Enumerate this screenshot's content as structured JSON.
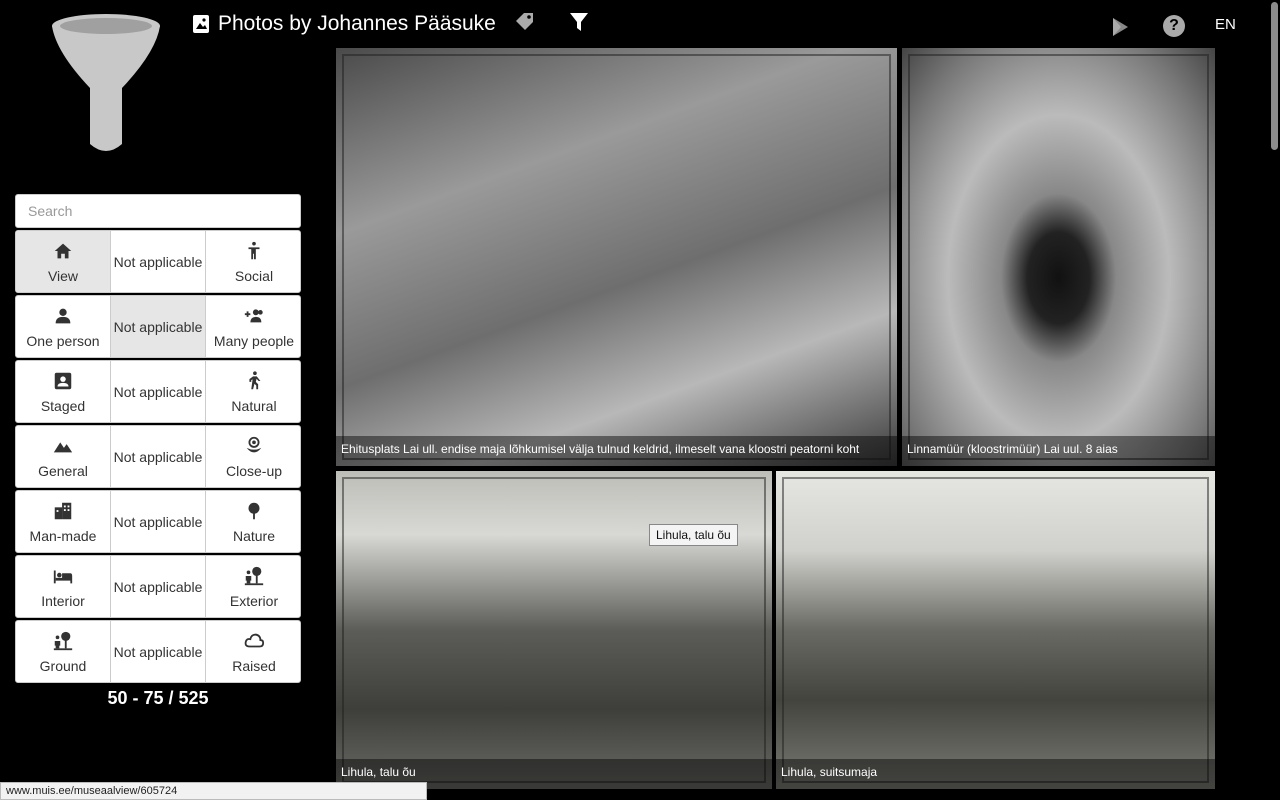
{
  "header": {
    "title": "Photos by Johannes Pääsuke",
    "language": "EN"
  },
  "icons": {
    "logo": "funnel-icon",
    "album": "image-icon",
    "tag": "tag-icon",
    "filter": "filter-icon",
    "play": "play-icon",
    "help": "help-icon"
  },
  "help_glyph": "?",
  "search": {
    "placeholder": "Search",
    "value": ""
  },
  "filters": [
    {
      "left": "View",
      "left_icon": "home-icon",
      "middle": "Not applicable",
      "right": "Social",
      "right_icon": "person-standing-icon",
      "active": "left"
    },
    {
      "left": "One person",
      "left_icon": "person-icon",
      "middle": "Not applicable",
      "right": "Many people",
      "right_icon": "group-add-icon",
      "active": "middle"
    },
    {
      "left": "Staged",
      "left_icon": "portrait-icon",
      "middle": "Not applicable",
      "right": "Natural",
      "right_icon": "walking-icon",
      "active": ""
    },
    {
      "left": "General",
      "left_icon": "landscape-icon",
      "middle": "Not applicable",
      "right": "Close-up",
      "right_icon": "flower-icon",
      "active": ""
    },
    {
      "left": "Man-made",
      "left_icon": "building-icon",
      "middle": "Not applicable",
      "right": "Nature",
      "right_icon": "tree-icon",
      "active": ""
    },
    {
      "left": "Interior",
      "left_icon": "bed-icon",
      "middle": "Not applicable",
      "right": "Exterior",
      "right_icon": "nature-person-icon",
      "active": ""
    },
    {
      "left": "Ground",
      "left_icon": "nature-person-icon",
      "middle": "Not applicable",
      "right": "Raised",
      "right_icon": "cloud-icon",
      "active": ""
    }
  ],
  "counter": "50 - 75 / 525",
  "photos": [
    {
      "caption": "Ehitusplats Lai ull. endise maja lõhkumisel välja tulnud keldrid, ilmeselt vana kloostri peatorni koht"
    },
    {
      "caption": "Linnamüür (kloostrimüür) Lai uul. 8 aias"
    },
    {
      "caption": "Lihula, talu õu"
    },
    {
      "caption": "Lihula, suitsumaja"
    }
  ],
  "tooltip": "Lihula, talu õu",
  "status_url": "www.muis.ee/museaalview/605724"
}
